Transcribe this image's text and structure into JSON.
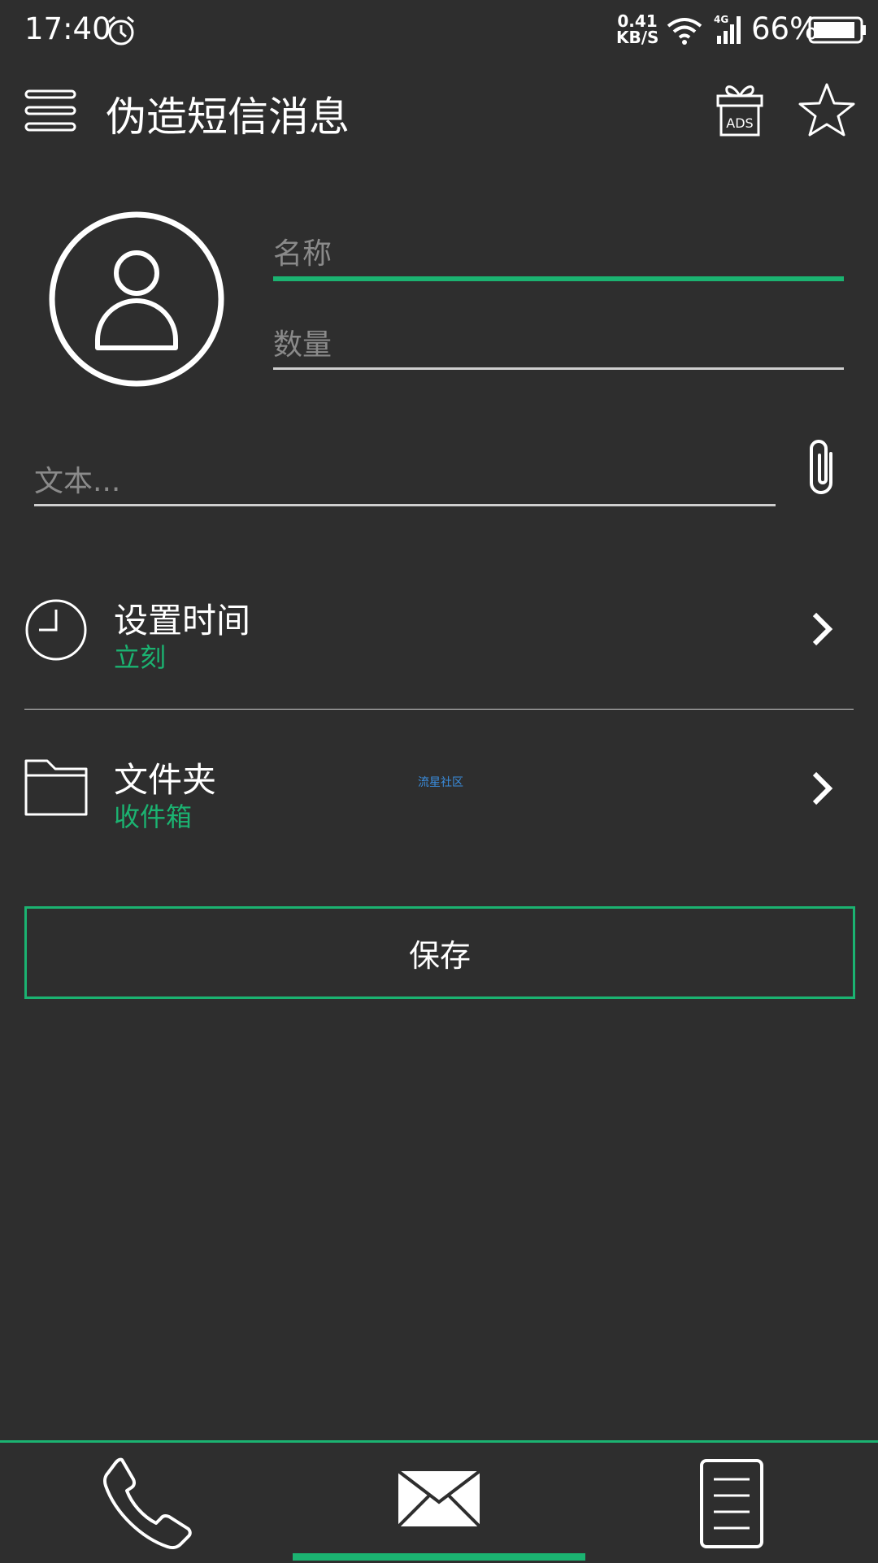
{
  "status_bar": {
    "time": "17:40",
    "net_speed_value": "0.41",
    "net_speed_unit": "KB/S",
    "network_type": "4G",
    "battery_percent": "66%",
    "icons": [
      "alarm-clock-icon",
      "wifi-icon",
      "signal-icon",
      "battery-icon"
    ]
  },
  "app_bar": {
    "title": "伪造短信消息",
    "ads_label": "ADS",
    "icons": [
      "menu-icon",
      "ads-gift-icon",
      "star-icon"
    ]
  },
  "form": {
    "name_placeholder": "名称",
    "count_placeholder": "数量",
    "text_placeholder": "文本..."
  },
  "rows": {
    "time_title": "设置时间",
    "time_value": "立刻",
    "folder_title": "文件夹",
    "folder_value": "收件箱"
  },
  "watermark": "流星社区",
  "save_label": "保存",
  "bottom_nav": {
    "items": [
      "phone-icon",
      "message-icon",
      "list-icon"
    ],
    "active": "message"
  },
  "colors": {
    "background": "#2e2e2e",
    "accent": "#1bb371",
    "text": "#ffffff",
    "placeholder": "#8a8a8a"
  }
}
